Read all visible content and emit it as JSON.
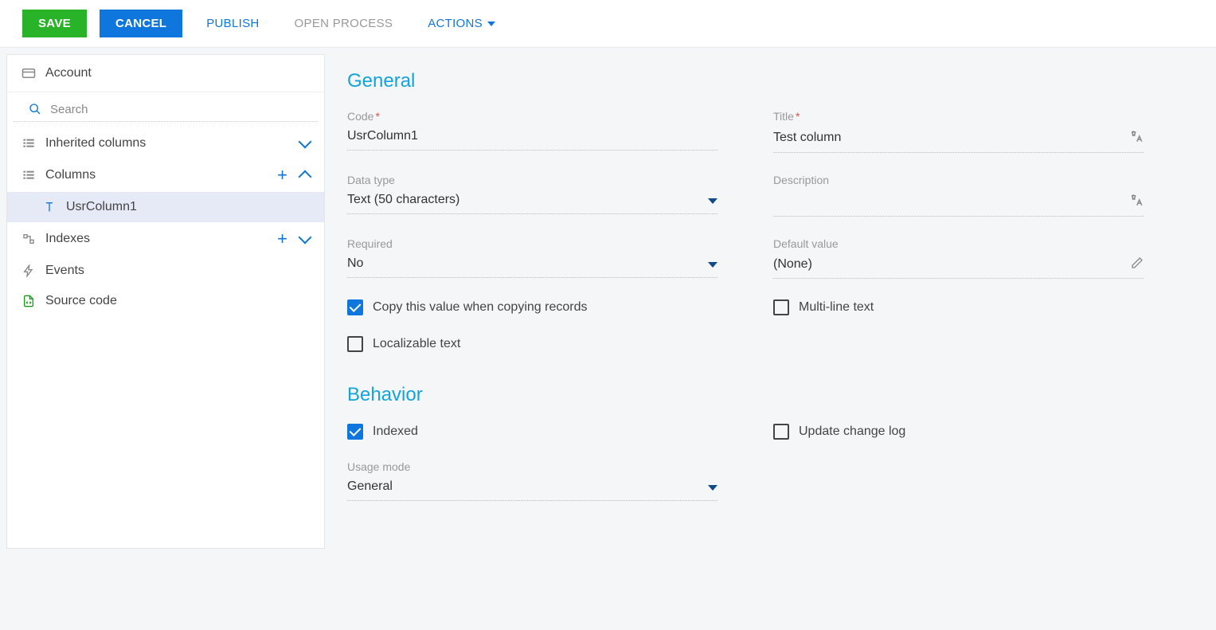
{
  "toolbar": {
    "save": "SAVE",
    "cancel": "CANCEL",
    "publish": "PUBLISH",
    "open_process": "OPEN PROCESS",
    "actions": "ACTIONS"
  },
  "sidebar": {
    "header": "Account",
    "search_placeholder": "Search",
    "inherited": "Inherited columns",
    "columns": "Columns",
    "column_item": "UsrColumn1",
    "indexes": "Indexes",
    "events": "Events",
    "source_code": "Source code"
  },
  "general": {
    "title": "General",
    "code_label": "Code",
    "code_value": "UsrColumn1",
    "title_label": "Title",
    "title_value": "Test column",
    "data_type_label": "Data type",
    "data_type_value": "Text (50 characters)",
    "description_label": "Description",
    "description_value": "",
    "required_label": "Required",
    "required_value": "No",
    "default_label": "Default value",
    "default_value": "(None)",
    "copy_label": "Copy this value when copying records",
    "multiline_label": "Multi-line text",
    "localizable_label": "Localizable text"
  },
  "behavior": {
    "title": "Behavior",
    "indexed_label": "Indexed",
    "update_log_label": "Update change log",
    "usage_label": "Usage mode",
    "usage_value": "General"
  }
}
